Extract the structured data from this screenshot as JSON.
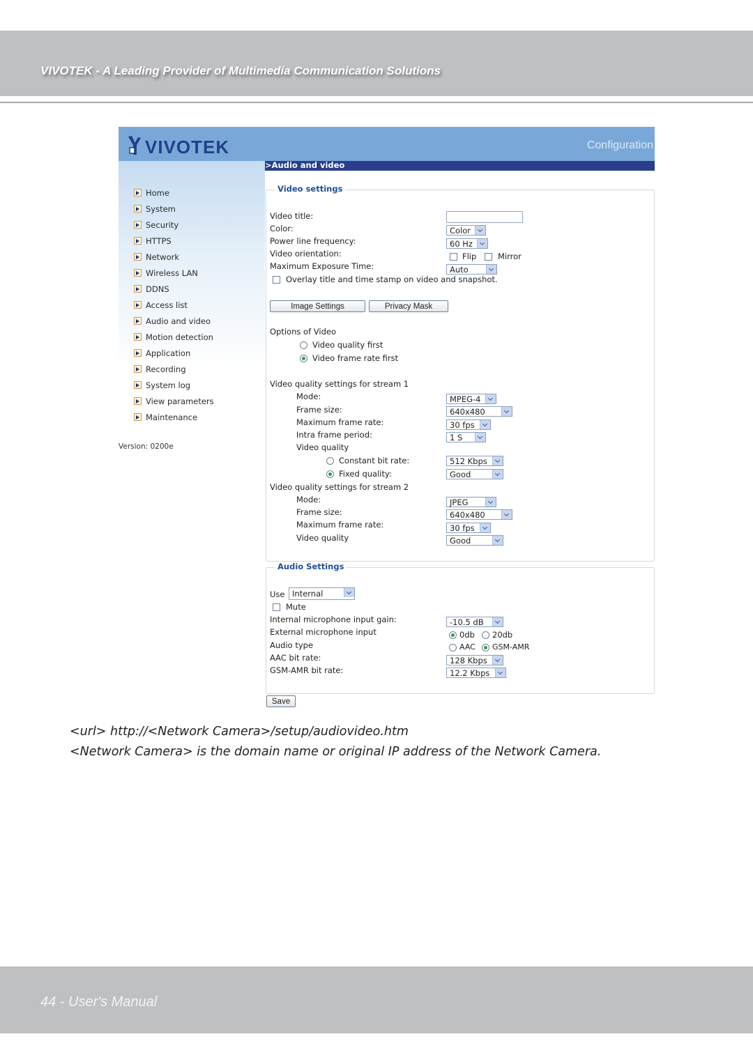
{
  "page_header": {
    "title": "VIVOTEK - A Leading Provider of Multimedia Communication Solutions"
  },
  "app": {
    "logo_text": "VIVOTEK",
    "logo_icon": "vivotek-camera-logo-icon",
    "banner_right": "Configuration",
    "breadcrumb": ">Audio and video",
    "version": "Version: 0200e",
    "colors": {
      "banner": "#79a8d8",
      "navbar": "#2a3e8b",
      "legend": "#1f4f99"
    }
  },
  "sidebar": {
    "items": [
      {
        "label": "Home"
      },
      {
        "label": "System"
      },
      {
        "label": "Security"
      },
      {
        "label": "HTTPS"
      },
      {
        "label": "Network"
      },
      {
        "label": "Wireless LAN"
      },
      {
        "label": "DDNS"
      },
      {
        "label": "Access list"
      },
      {
        "label": "Audio and video"
      },
      {
        "label": "Motion detection"
      },
      {
        "label": "Application"
      },
      {
        "label": "Recording"
      },
      {
        "label": "System log"
      },
      {
        "label": "View parameters"
      },
      {
        "label": "Maintenance"
      }
    ]
  },
  "video": {
    "legend": "Video settings",
    "video_title_label": "Video title:",
    "video_title_value": "",
    "color_label": "Color:",
    "color_value": "Color",
    "power_label": "Power line frequency:",
    "power_value": "60 Hz",
    "orientation_label": "Video orientation:",
    "flip_label": "Flip",
    "flip_checked": false,
    "mirror_label": "Mirror",
    "mirror_checked": false,
    "exposure_label": "Maximum Exposure Time:",
    "exposure_value": "Auto",
    "overlay_label": "Overlay title and time stamp on video and snapshot.",
    "overlay_checked": false,
    "image_settings_button": "Image Settings",
    "privacy_mask_button": "Privacy Mask",
    "options_label": "Options of Video",
    "option_quality_first": "Video quality first",
    "option_framerate_first": "Video frame rate first",
    "selected_option": "Video frame rate first",
    "stream1": {
      "heading": "Video quality settings for stream 1",
      "mode_label": "Mode:",
      "mode_value": "MPEG-4",
      "frame_size_label": "Frame size:",
      "frame_size_value": "640x480",
      "max_fps_label": "Maximum frame rate:",
      "max_fps_value": "30 fps",
      "intra_label": "Intra frame period:",
      "intra_value": "1 S",
      "quality_label": "Video quality",
      "cbr_label": "Constant bit rate:",
      "cbr_value": "512 Kbps",
      "fixed_label": "Fixed quality:",
      "fixed_value": "Good",
      "selected": "Fixed quality"
    },
    "stream2": {
      "heading": "Video quality settings for stream 2",
      "mode_label": "Mode:",
      "mode_value": "JPEG",
      "frame_size_label": "Frame size:",
      "frame_size_value": "640x480",
      "max_fps_label": "Maximum frame rate:",
      "max_fps_value": "30 fps",
      "quality_label": "Video quality",
      "quality_value": "Good"
    }
  },
  "audio": {
    "legend": "Audio Settings",
    "use_label": "Use",
    "use_value": "Internal",
    "mute_label": "Mute",
    "mute_checked": false,
    "gain_label": "Internal microphone input gain:",
    "gain_value": "-10.5 dB",
    "ext_label": "External microphone input",
    "ext_0db": "0db",
    "ext_20db": "20db",
    "ext_selected": "0db",
    "type_label": "Audio type",
    "type_aac": "AAC",
    "type_gsm": "GSM-AMR",
    "type_selected": "GSM-AMR",
    "aac_label": "AAC bit rate:",
    "aac_value": "128 Kbps",
    "gsm_label": "GSM-AMR bit rate:",
    "gsm_value": "12.2 Kbps"
  },
  "save_button": "Save",
  "captions": {
    "url_line": "<url> http://<Network Camera>/setup/audiovideo.htm",
    "note_line": "<Network Camera> is the domain name or original IP address of the Network Camera."
  },
  "page_footer": {
    "text": "44 - User's Manual"
  }
}
